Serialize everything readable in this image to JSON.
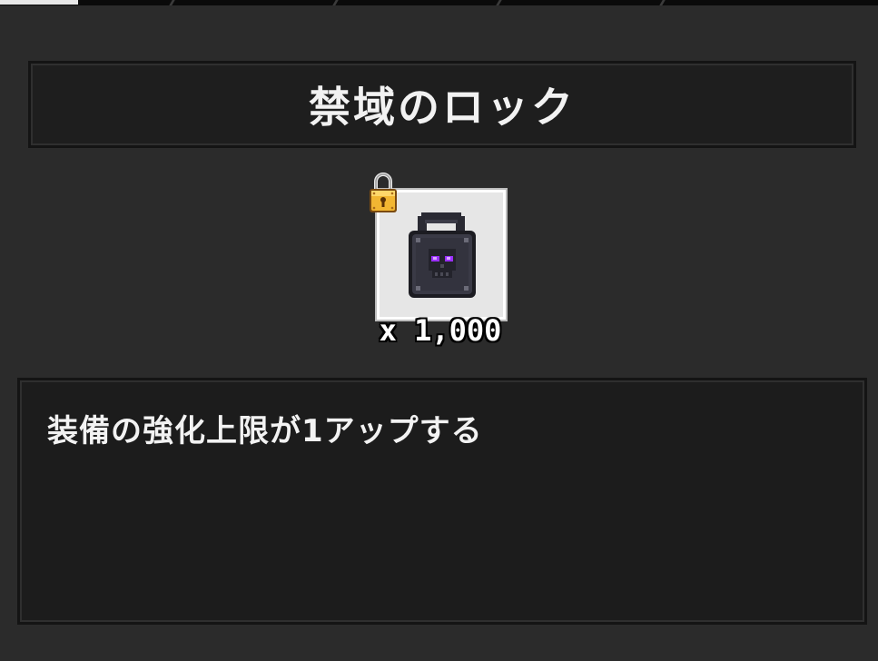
{
  "item": {
    "name": "禁域のロック",
    "quantity_label": "x 1,000",
    "description": "装備の強化上限が1アップする",
    "icon": "dark-skull-lock-icon",
    "locked_badge_icon": "gold-padlock-icon"
  },
  "colors": {
    "background": "#2b2b2b",
    "panel": "#1e1e1e",
    "slot_background": "#e6e6e6",
    "skull_eye": "#9b30ff",
    "padlock_gold": "#f2b632"
  }
}
